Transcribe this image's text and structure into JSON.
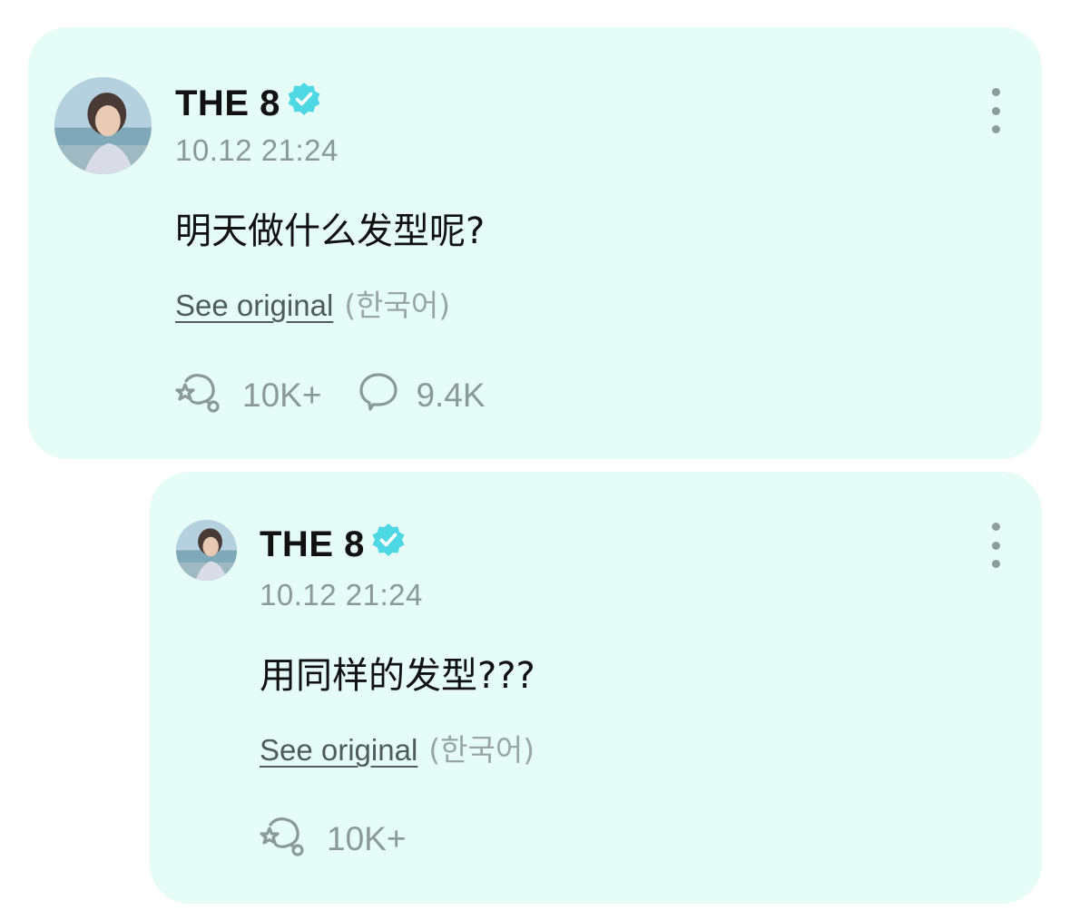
{
  "post": {
    "author": "THE 8",
    "verified": true,
    "timestamp": "10.12 21:24",
    "text": "明天做什么发型呢?",
    "see_original": "See original",
    "original_language": "(한국어)",
    "likes": "10K+",
    "comments": "9.4K"
  },
  "reply": {
    "author": "THE 8",
    "verified": true,
    "timestamp": "10.12 21:24",
    "text": "用同样的发型???",
    "see_original": "See original",
    "original_language": "(한국어)",
    "likes": "10K+"
  },
  "colors": {
    "card_background": "#e6fcf7",
    "verified_badge": "#4dd8e4",
    "secondary_text": "#8a9a98",
    "primary_text": "#111111"
  },
  "icons": {
    "verified": "verified-badge-icon",
    "like": "like-reaction-icon",
    "comment": "comment-bubble-icon",
    "more": "more-vertical-icon"
  }
}
